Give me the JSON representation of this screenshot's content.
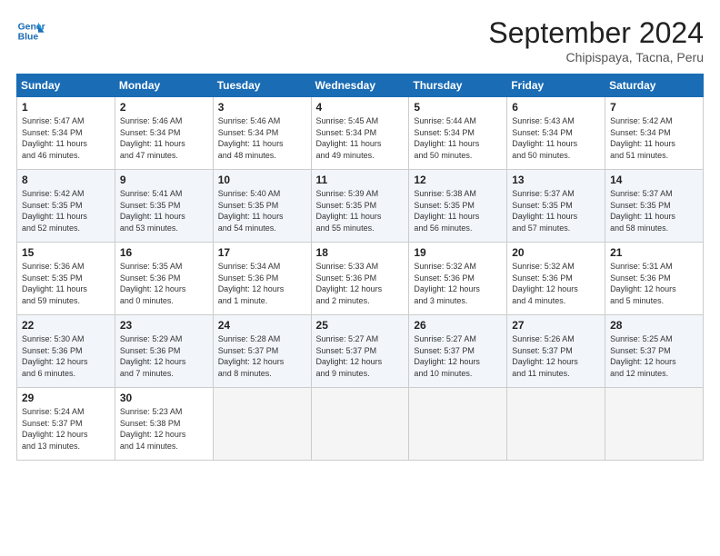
{
  "header": {
    "logo_line1": "General",
    "logo_line2": "Blue",
    "month": "September 2024",
    "location": "Chipispaya, Tacna, Peru"
  },
  "weekdays": [
    "Sunday",
    "Monday",
    "Tuesday",
    "Wednesday",
    "Thursday",
    "Friday",
    "Saturday"
  ],
  "weeks": [
    [
      {
        "day": "1",
        "info": "Sunrise: 5:47 AM\nSunset: 5:34 PM\nDaylight: 11 hours\nand 46 minutes."
      },
      {
        "day": "2",
        "info": "Sunrise: 5:46 AM\nSunset: 5:34 PM\nDaylight: 11 hours\nand 47 minutes."
      },
      {
        "day": "3",
        "info": "Sunrise: 5:46 AM\nSunset: 5:34 PM\nDaylight: 11 hours\nand 48 minutes."
      },
      {
        "day": "4",
        "info": "Sunrise: 5:45 AM\nSunset: 5:34 PM\nDaylight: 11 hours\nand 49 minutes."
      },
      {
        "day": "5",
        "info": "Sunrise: 5:44 AM\nSunset: 5:34 PM\nDaylight: 11 hours\nand 50 minutes."
      },
      {
        "day": "6",
        "info": "Sunrise: 5:43 AM\nSunset: 5:34 PM\nDaylight: 11 hours\nand 50 minutes."
      },
      {
        "day": "7",
        "info": "Sunrise: 5:42 AM\nSunset: 5:34 PM\nDaylight: 11 hours\nand 51 minutes."
      }
    ],
    [
      {
        "day": "8",
        "info": "Sunrise: 5:42 AM\nSunset: 5:35 PM\nDaylight: 11 hours\nand 52 minutes."
      },
      {
        "day": "9",
        "info": "Sunrise: 5:41 AM\nSunset: 5:35 PM\nDaylight: 11 hours\nand 53 minutes."
      },
      {
        "day": "10",
        "info": "Sunrise: 5:40 AM\nSunset: 5:35 PM\nDaylight: 11 hours\nand 54 minutes."
      },
      {
        "day": "11",
        "info": "Sunrise: 5:39 AM\nSunset: 5:35 PM\nDaylight: 11 hours\nand 55 minutes."
      },
      {
        "day": "12",
        "info": "Sunrise: 5:38 AM\nSunset: 5:35 PM\nDaylight: 11 hours\nand 56 minutes."
      },
      {
        "day": "13",
        "info": "Sunrise: 5:37 AM\nSunset: 5:35 PM\nDaylight: 11 hours\nand 57 minutes."
      },
      {
        "day": "14",
        "info": "Sunrise: 5:37 AM\nSunset: 5:35 PM\nDaylight: 11 hours\nand 58 minutes."
      }
    ],
    [
      {
        "day": "15",
        "info": "Sunrise: 5:36 AM\nSunset: 5:35 PM\nDaylight: 11 hours\nand 59 minutes."
      },
      {
        "day": "16",
        "info": "Sunrise: 5:35 AM\nSunset: 5:36 PM\nDaylight: 12 hours\nand 0 minutes."
      },
      {
        "day": "17",
        "info": "Sunrise: 5:34 AM\nSunset: 5:36 PM\nDaylight: 12 hours\nand 1 minute."
      },
      {
        "day": "18",
        "info": "Sunrise: 5:33 AM\nSunset: 5:36 PM\nDaylight: 12 hours\nand 2 minutes."
      },
      {
        "day": "19",
        "info": "Sunrise: 5:32 AM\nSunset: 5:36 PM\nDaylight: 12 hours\nand 3 minutes."
      },
      {
        "day": "20",
        "info": "Sunrise: 5:32 AM\nSunset: 5:36 PM\nDaylight: 12 hours\nand 4 minutes."
      },
      {
        "day": "21",
        "info": "Sunrise: 5:31 AM\nSunset: 5:36 PM\nDaylight: 12 hours\nand 5 minutes."
      }
    ],
    [
      {
        "day": "22",
        "info": "Sunrise: 5:30 AM\nSunset: 5:36 PM\nDaylight: 12 hours\nand 6 minutes."
      },
      {
        "day": "23",
        "info": "Sunrise: 5:29 AM\nSunset: 5:36 PM\nDaylight: 12 hours\nand 7 minutes."
      },
      {
        "day": "24",
        "info": "Sunrise: 5:28 AM\nSunset: 5:37 PM\nDaylight: 12 hours\nand 8 minutes."
      },
      {
        "day": "25",
        "info": "Sunrise: 5:27 AM\nSunset: 5:37 PM\nDaylight: 12 hours\nand 9 minutes."
      },
      {
        "day": "26",
        "info": "Sunrise: 5:27 AM\nSunset: 5:37 PM\nDaylight: 12 hours\nand 10 minutes."
      },
      {
        "day": "27",
        "info": "Sunrise: 5:26 AM\nSunset: 5:37 PM\nDaylight: 12 hours\nand 11 minutes."
      },
      {
        "day": "28",
        "info": "Sunrise: 5:25 AM\nSunset: 5:37 PM\nDaylight: 12 hours\nand 12 minutes."
      }
    ],
    [
      {
        "day": "29",
        "info": "Sunrise: 5:24 AM\nSunset: 5:37 PM\nDaylight: 12 hours\nand 13 minutes."
      },
      {
        "day": "30",
        "info": "Sunrise: 5:23 AM\nSunset: 5:38 PM\nDaylight: 12 hours\nand 14 minutes."
      },
      {
        "day": "",
        "info": ""
      },
      {
        "day": "",
        "info": ""
      },
      {
        "day": "",
        "info": ""
      },
      {
        "day": "",
        "info": ""
      },
      {
        "day": "",
        "info": ""
      }
    ]
  ]
}
